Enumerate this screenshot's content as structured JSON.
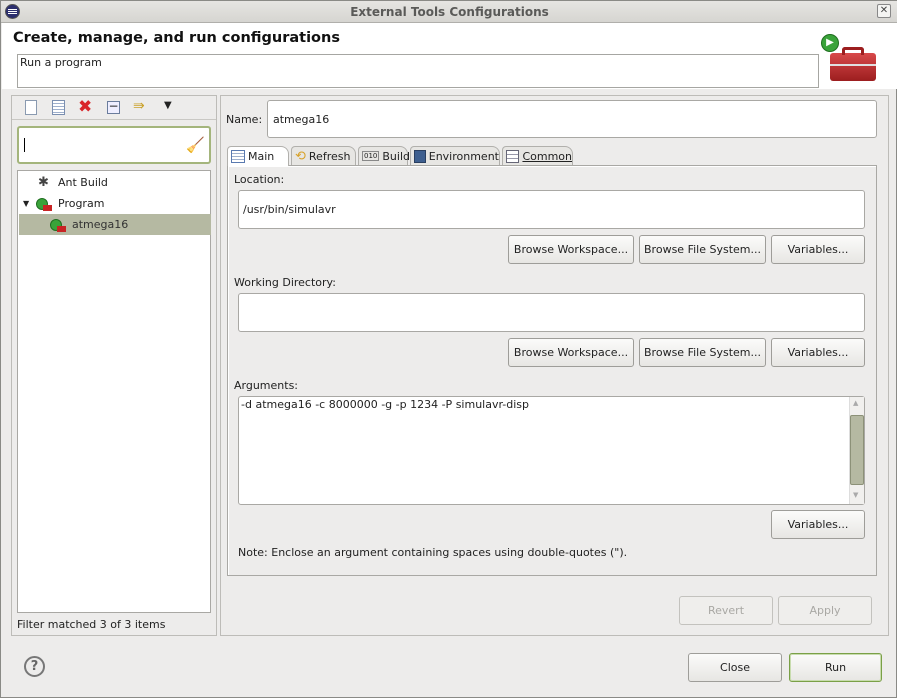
{
  "window": {
    "title": "External Tools Configurations"
  },
  "header": {
    "title": "Create, manage, and run configurations",
    "description": "Run a program"
  },
  "sidebar": {
    "toolbar": [
      "new-configuration-icon",
      "duplicate-icon",
      "delete-icon",
      "collapse-all-icon",
      "filter-icon",
      "view-menu-icon"
    ],
    "filter_value": "",
    "tree": [
      {
        "label": "Ant Build",
        "icon": "ant-icon",
        "level": 0
      },
      {
        "label": "Program",
        "icon": "program-icon",
        "level": 0,
        "expanded": true
      },
      {
        "label": "atmega16",
        "icon": "program-icon",
        "level": 1,
        "selected": true
      }
    ],
    "status": "Filter matched 3 of 3 items"
  },
  "editor": {
    "name_label": "Name:",
    "name_value": "atmega16",
    "tabs": [
      {
        "label": "Main",
        "active": true
      },
      {
        "label": "Refresh"
      },
      {
        "label": "Build"
      },
      {
        "label": "Environment"
      },
      {
        "label": "Common"
      }
    ],
    "location_label": "Location:",
    "location_value": "/usr/bin/simulavr",
    "working_dir_label": "Working Directory:",
    "working_dir_value": "",
    "arguments_label": "Arguments:",
    "arguments_value": "-d atmega16 -c 8000000 -g -p 1234 -P simulavr-disp",
    "browse_workspace": "Browse Workspace...",
    "browse_fs": "Browse File System...",
    "variables": "Variables...",
    "note": "Note: Enclose an argument containing spaces using double-quotes (\").",
    "revert": "Revert",
    "apply": "Apply"
  },
  "footer": {
    "close": "Close",
    "run": "Run"
  },
  "colors": {
    "selection": "#b5b9a2",
    "run_border": "#7aa047"
  }
}
